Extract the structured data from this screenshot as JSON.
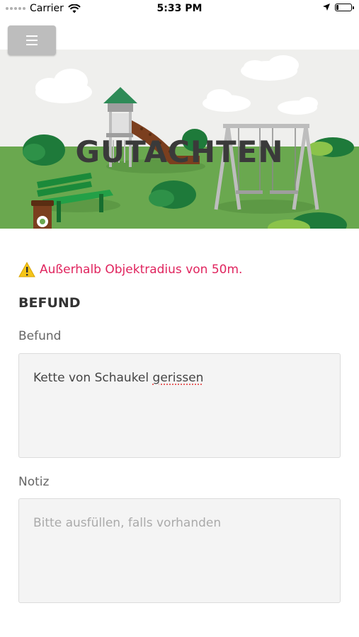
{
  "status_bar": {
    "carrier": "Carrier",
    "time": "5:33 PM",
    "icons": [
      "signal-dots-icon",
      "wifi-icon",
      "location-arrow-icon",
      "battery-icon"
    ]
  },
  "header": {
    "menu_icon": "hamburger-menu-icon",
    "title": "GUTACHTEN"
  },
  "main": {
    "warning_icon": "warning-triangle-icon",
    "warning_text": "Außerhalb Objektradius von 50m.",
    "section_title": "BEFUND",
    "befund": {
      "label": "Befund",
      "value_prefix": "Kette von Schaukel ",
      "value_misspelled": "gerissen"
    },
    "notiz": {
      "label": "Notiz",
      "value": "",
      "placeholder": "Bitte ausfüllen, falls vorhanden"
    }
  },
  "colors": {
    "warning": "#e0245e",
    "grass": "#6aa84f",
    "sky": "#efefef",
    "menu_button": "#bdbdbd",
    "field_bg": "#f4f4f4"
  }
}
